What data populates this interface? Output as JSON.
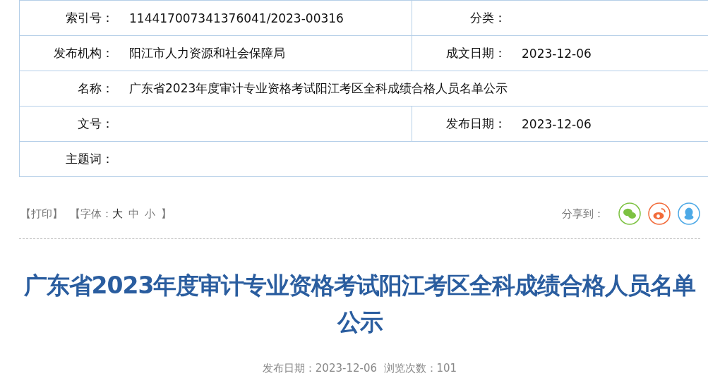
{
  "info_table": {
    "rows": [
      {
        "cells": [
          {
            "label": "索引号：",
            "value": "114417007341376041/2023-00316"
          },
          {
            "label": "分类："
          }
        ]
      },
      {
        "cells": [
          {
            "label": "发布机构：",
            "value": "阳江市人力资源和社会保障局"
          },
          {
            "label": "成文日期：",
            "value": "2023-12-06"
          }
        ]
      },
      {
        "cells": [
          {
            "label": "名称：",
            "value": "广东省2023年度审计专业资格考试阳江考区全科成绩合格人员名单公示"
          }
        ]
      },
      {
        "cells": [
          {
            "label": "文号："
          },
          {
            "label": "发布日期：",
            "value": "2023-12-06"
          }
        ]
      },
      {
        "cells": [
          {
            "label": "主题词："
          }
        ]
      }
    ]
  },
  "toolbar": {
    "print": "【打印】",
    "font_label": "【字体：",
    "font_sizes": [
      {
        "label": "大",
        "selected": true
      },
      {
        "label": "中",
        "selected": false
      },
      {
        "label": "小",
        "selected": false
      }
    ],
    "font_close": "】",
    "share_label": "分享到：",
    "share_targets": [
      {
        "kind": "wechat",
        "color": "#7dc242"
      },
      {
        "kind": "weibo",
        "color": "#f26b3a"
      },
      {
        "kind": "qq",
        "color": "#4da9e6"
      }
    ]
  },
  "article": {
    "title": "广东省2023年度审计专业资格考试阳江考区全科成绩合格人员名单公示",
    "meta": "发布日期：2023-12-06  浏览次数：101"
  }
}
